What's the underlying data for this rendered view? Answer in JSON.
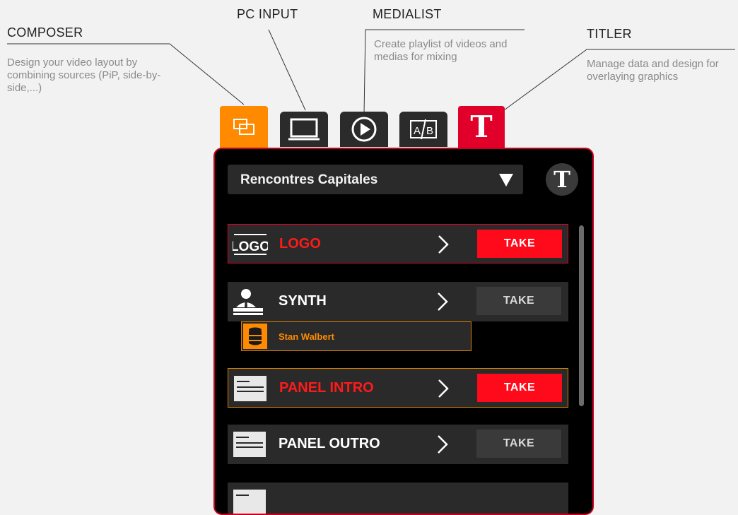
{
  "callouts": {
    "composer": {
      "title": "COMPOSER",
      "desc": "Design your video layout by combining sources (PiP, side-by-side,...)"
    },
    "pc_input": {
      "title": "PC INPUT"
    },
    "medialist": {
      "title": "MEDIALIST",
      "desc": "Create playlist of videos and medias for mixing"
    },
    "titler": {
      "title": "TITLER",
      "desc": "Manage data and design for overlaying graphics"
    }
  },
  "tabs": [
    {
      "name": "composer",
      "icon": "composer-icon",
      "active": true,
      "color": "#ff8a00"
    },
    {
      "name": "pc-input",
      "icon": "monitor-icon"
    },
    {
      "name": "medialist",
      "icon": "play-icon"
    },
    {
      "name": "ab",
      "icon": "ab-transition-icon",
      "label": "A/B"
    },
    {
      "name": "titler",
      "icon": "titler-icon",
      "label": "T",
      "color": "#e0002a"
    }
  ],
  "panel": {
    "dropdown": {
      "value": "Rencontres Capitales"
    },
    "badge": "T",
    "rows": [
      {
        "label": "LOGO",
        "icon": "logo-icon",
        "icon_text": "LOGO",
        "take": "TAKE",
        "on_air": true
      },
      {
        "label": "SYNTH",
        "icon": "person-icon",
        "take": "TAKE",
        "on_air": false
      },
      {
        "label": "PANEL INTRO",
        "icon": "panel-icon",
        "take": "TAKE",
        "on_air": true
      },
      {
        "label": "PANEL OUTRO",
        "icon": "panel-icon",
        "take": "TAKE",
        "on_air": false
      }
    ],
    "data_source": {
      "label": "Stan Walbert",
      "icon": "database-icon"
    }
  },
  "colors": {
    "accent_red": "#ff0a1a",
    "accent_orange": "#ff8a00",
    "panel_bg": "#000000"
  }
}
